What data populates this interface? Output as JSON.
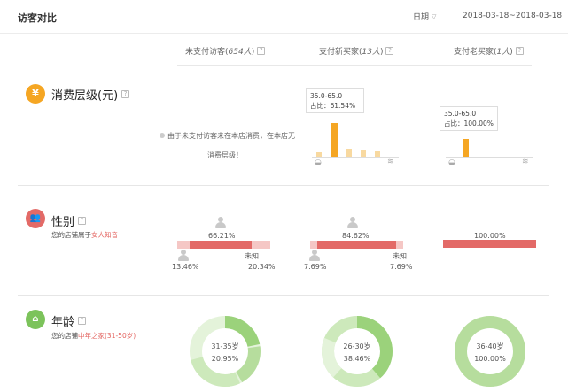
{
  "header": {
    "title": "访客对比",
    "date_label": "日期",
    "date_range": "2018-03-18~2018-03-18"
  },
  "columns": [
    {
      "label_prefix": "未支付访客(",
      "count": "654人",
      "label_suffix": ")"
    },
    {
      "label_prefix": "支付新买家(",
      "count": "13人",
      "label_suffix": ")"
    },
    {
      "label_prefix": "支付老买家(",
      "count": "1人",
      "label_suffix": ")"
    }
  ],
  "spending": {
    "icon": "¥",
    "title": "消费层级(元)",
    "note_line1": "由于未支付访客未在本店消费，在本店无",
    "note_line2": "消费层级！",
    "new_tip": {
      "range": "35.0-65.0",
      "share": "占比：61.54%"
    },
    "old_tip": {
      "range": "35.0-65.0",
      "share": "占比：100.00%"
    },
    "colors": {
      "highlight": "#f5a623",
      "light": "#f8d9a0"
    }
  },
  "gender": {
    "title": "性别",
    "sub_prefix": "您的店铺属于",
    "sub_highlight": "女人知音",
    "unknown": "未知",
    "columns": [
      {
        "female": "66.21%",
        "male": "13.46%",
        "unknown_pct": "20.34%",
        "female_share": 0.6621,
        "male_share": 0.1346
      },
      {
        "female": "84.62%",
        "male": "7.69%",
        "unknown_pct": "7.69%",
        "female_share": 0.8462,
        "male_share": 0.0769
      },
      {
        "female": "100.00%",
        "female_share": 1.0
      }
    ],
    "colors": {
      "fill": "#e36a67",
      "track": "#f5c7c5"
    }
  },
  "age": {
    "title": "年龄",
    "sub_prefix": "您的店铺",
    "sub_highlight": "中年之家(31-50岁)",
    "donuts": [
      {
        "range": "31-35岁",
        "pct": "20.95%"
      },
      {
        "range": "26-30岁",
        "pct": "38.46%"
      },
      {
        "range": "36-40岁",
        "pct": "100.00%"
      }
    ],
    "colors": {
      "main": "#9bd27b",
      "light": "#cde9bb",
      "pale": "#e4f3da"
    }
  },
  "icons": {
    "spending": "yen-icon",
    "gender": "people-icon",
    "age": "building-icon",
    "help": "question-icon",
    "coins": "coin-stack-icon",
    "person": "person-icon"
  },
  "accent": "#e3635f"
}
